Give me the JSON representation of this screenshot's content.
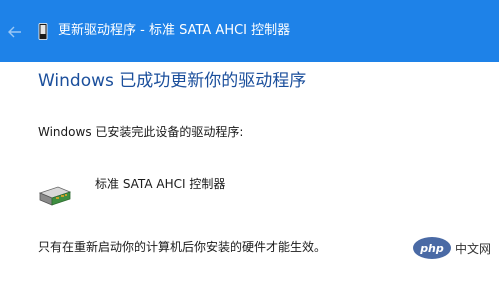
{
  "window": {
    "title": "更新驱动程序 - 标准 SATA AHCI 控制器",
    "back_icon": "back-arrow-icon",
    "device_icon": "device-icon",
    "accent_color": "#1e82e8"
  },
  "content": {
    "heading": "Windows 已成功更新你的驱动程序",
    "installed_text": "Windows 已安装完此设备的驱动程序:",
    "driver_name": "标准 SATA AHCI 控制器",
    "driver_icon": "storage-controller-icon",
    "restart_notice": "只有在重新启动你的计算机后你安装的硬件才能生效。"
  },
  "watermark": {
    "logo_text": "php",
    "site_text": "中文网"
  }
}
